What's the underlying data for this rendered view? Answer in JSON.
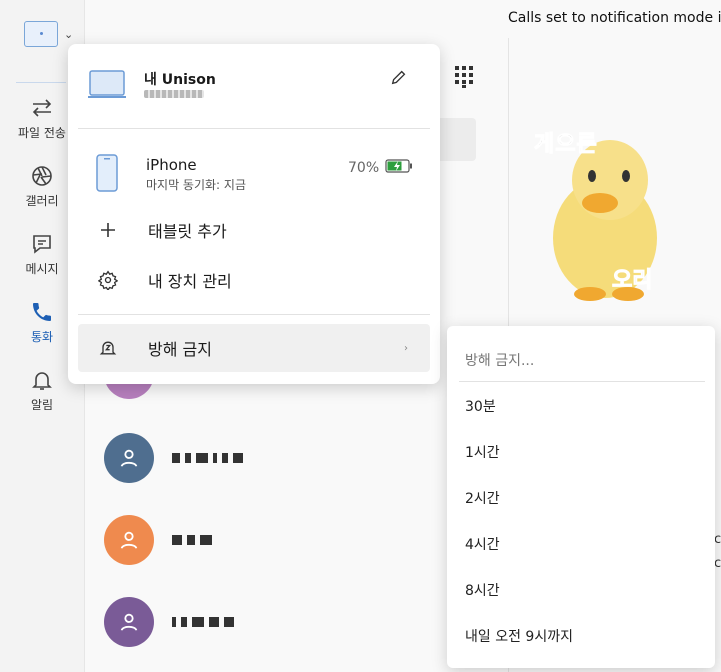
{
  "notification": "Calls set to notification mode in",
  "nav": {
    "items": [
      {
        "label": "파일 전송",
        "icon": "transfer-arrows-icon"
      },
      {
        "label": "갤러리",
        "icon": "aperture-icon"
      },
      {
        "label": "메시지",
        "icon": "chat-bubble-icon"
      },
      {
        "label": "통화",
        "icon": "phone-icon",
        "active": true
      },
      {
        "label": "알림",
        "icon": "bell-icon"
      }
    ]
  },
  "flyout": {
    "pc_name": "내 Unison",
    "phone_name": "iPhone",
    "phone_status": "마지막 동기화: 지금",
    "battery": "70%",
    "add_tablet": "태블릿 추가",
    "manage_devices": "내 장치 관리",
    "dnd": "방해 금지"
  },
  "dnd_menu": {
    "header": "방해 금지...",
    "options": [
      "30분",
      "1시간",
      "2시간",
      "4시간",
      "8시간",
      "내일 오전 9시까지"
    ]
  },
  "sticker": {
    "line1": "게으른",
    "line2": "오리"
  },
  "edge_chars": [
    "c",
    "c"
  ],
  "colors": {
    "accent": "#1d5fb4",
    "battery": "#2e9e3e"
  }
}
